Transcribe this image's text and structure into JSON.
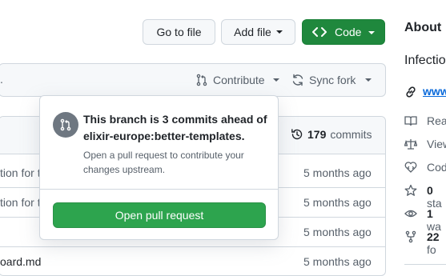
{
  "toolbar": {
    "go_to_file": "Go to file",
    "add_file": "Add file",
    "code": "Code"
  },
  "about": {
    "heading": "About",
    "description": "Infectio",
    "website": "www",
    "links": [
      {
        "label": "Rea",
        "icon": "book-icon"
      },
      {
        "label": "View",
        "icon": "scale-icon"
      },
      {
        "label": "Cod",
        "icon": "heart-code-icon"
      },
      {
        "label": "0",
        "suffix": "sta",
        "icon": "star-icon"
      },
      {
        "label": "1",
        "suffix": "wa",
        "icon": "eye-icon"
      },
      {
        "label": "22",
        "suffix": "fo",
        "icon": "fork-icon"
      }
    ]
  },
  "branch_bar": {
    "ellipsis": ".",
    "contribute": "Contribute",
    "sync_fork": "Sync fork"
  },
  "commits": {
    "count": "179",
    "label": "commits"
  },
  "files": [
    {
      "name": "tion for t",
      "time": "5 months ago"
    },
    {
      "name": "tion for t",
      "time": "5 months ago"
    },
    {
      "name": "",
      "time": "5 months ago"
    },
    {
      "name": "oard.md",
      "time": "5 months ago"
    }
  ],
  "popover": {
    "title": "This branch is 3 commits ahead of elixir-europe:better-templates.",
    "description": "Open a pull request to contribute your changes upstream.",
    "button": "Open pull request"
  },
  "colors": {
    "green": "#1f883d",
    "popover_button": "#2da44e",
    "link": "#0969da"
  }
}
